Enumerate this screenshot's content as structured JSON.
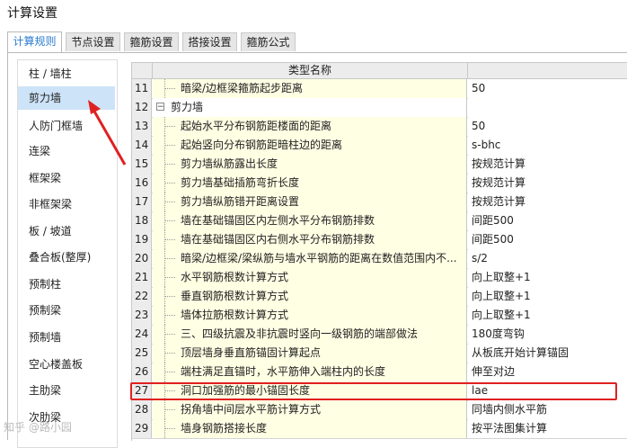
{
  "window": {
    "title": "计算设置"
  },
  "tabs": [
    {
      "label": "计算规则",
      "active": true
    },
    {
      "label": "节点设置",
      "active": false
    },
    {
      "label": "箍筋设置",
      "active": false
    },
    {
      "label": "搭接设置",
      "active": false
    },
    {
      "label": "箍筋公式",
      "active": false
    }
  ],
  "sidebar": {
    "items": [
      {
        "label": "柱 / 墙柱"
      },
      {
        "label": "剪力墙",
        "selected": true
      },
      {
        "label": "人防门框墙"
      },
      {
        "label": "连梁"
      },
      {
        "label": "框架梁"
      },
      {
        "label": "非框架梁"
      },
      {
        "label": "板 / 坡道"
      },
      {
        "label": "叠合板(整厚)"
      },
      {
        "label": "预制柱"
      },
      {
        "label": "预制梁"
      },
      {
        "label": "预制墙"
      },
      {
        "label": "空心楼盖板"
      },
      {
        "label": "主肋梁"
      },
      {
        "label": "次肋梁"
      }
    ]
  },
  "table": {
    "header": "类型名称",
    "rows": [
      {
        "num": "11",
        "name": "暗梁/边框梁箍筋起步距离",
        "value": "50"
      },
      {
        "num": "12",
        "name": "剪力墙",
        "value": "",
        "group": true
      },
      {
        "num": "13",
        "name": "起始水平分布钢筋距楼面的距离",
        "value": "50"
      },
      {
        "num": "14",
        "name": "起始竖向分布钢筋距暗柱边的距离",
        "value": "s-bhc"
      },
      {
        "num": "15",
        "name": "剪力墙纵筋露出长度",
        "value": "按规范计算"
      },
      {
        "num": "16",
        "name": "剪力墙基础插筋弯折长度",
        "value": "按规范计算"
      },
      {
        "num": "17",
        "name": "剪力墙纵筋错开距离设置",
        "value": "按规范计算"
      },
      {
        "num": "18",
        "name": "墙在基础锚固区内左侧水平分布钢筋排数",
        "value": "间距500"
      },
      {
        "num": "19",
        "name": "墙在基础锚固区内右侧水平分布钢筋排数",
        "value": "间距500"
      },
      {
        "num": "20",
        "name": "暗梁/边框梁/梁纵筋与墙水平钢筋的距离在数值范围内不...",
        "value": "s/2"
      },
      {
        "num": "21",
        "name": "水平钢筋根数计算方式",
        "value": "向上取整+1"
      },
      {
        "num": "22",
        "name": "垂直钢筋根数计算方式",
        "value": "向上取整+1"
      },
      {
        "num": "23",
        "name": "墙体拉筋根数计算方式",
        "value": "向上取整+1"
      },
      {
        "num": "24",
        "name": "三、四级抗震及非抗震时竖向一级钢筋的端部做法",
        "value": "180度弯钩"
      },
      {
        "num": "25",
        "name": "顶层墙身垂直筋锚固计算起点",
        "value": "从板底开始计算锚固"
      },
      {
        "num": "26",
        "name": "端柱满足直锚时，水平筋伸入端柱内的长度",
        "value": "伸至对边"
      },
      {
        "num": "27",
        "name": "洞口加强筋的最小锚固长度",
        "value": "lae",
        "highlight": true
      },
      {
        "num": "28",
        "name": "拐角墙中间层水平筋计算方式",
        "value": "同墙内侧水平筋"
      },
      {
        "num": "29",
        "name": "墙身钢筋搭接长度",
        "value": "按平法图集计算"
      }
    ]
  },
  "colors": {
    "accent": "#2a7bd0",
    "selected": "#cde3f7",
    "highlight": "#e02020",
    "name_cell": "#ffffe4"
  },
  "watermark": "知乎 @路小园"
}
